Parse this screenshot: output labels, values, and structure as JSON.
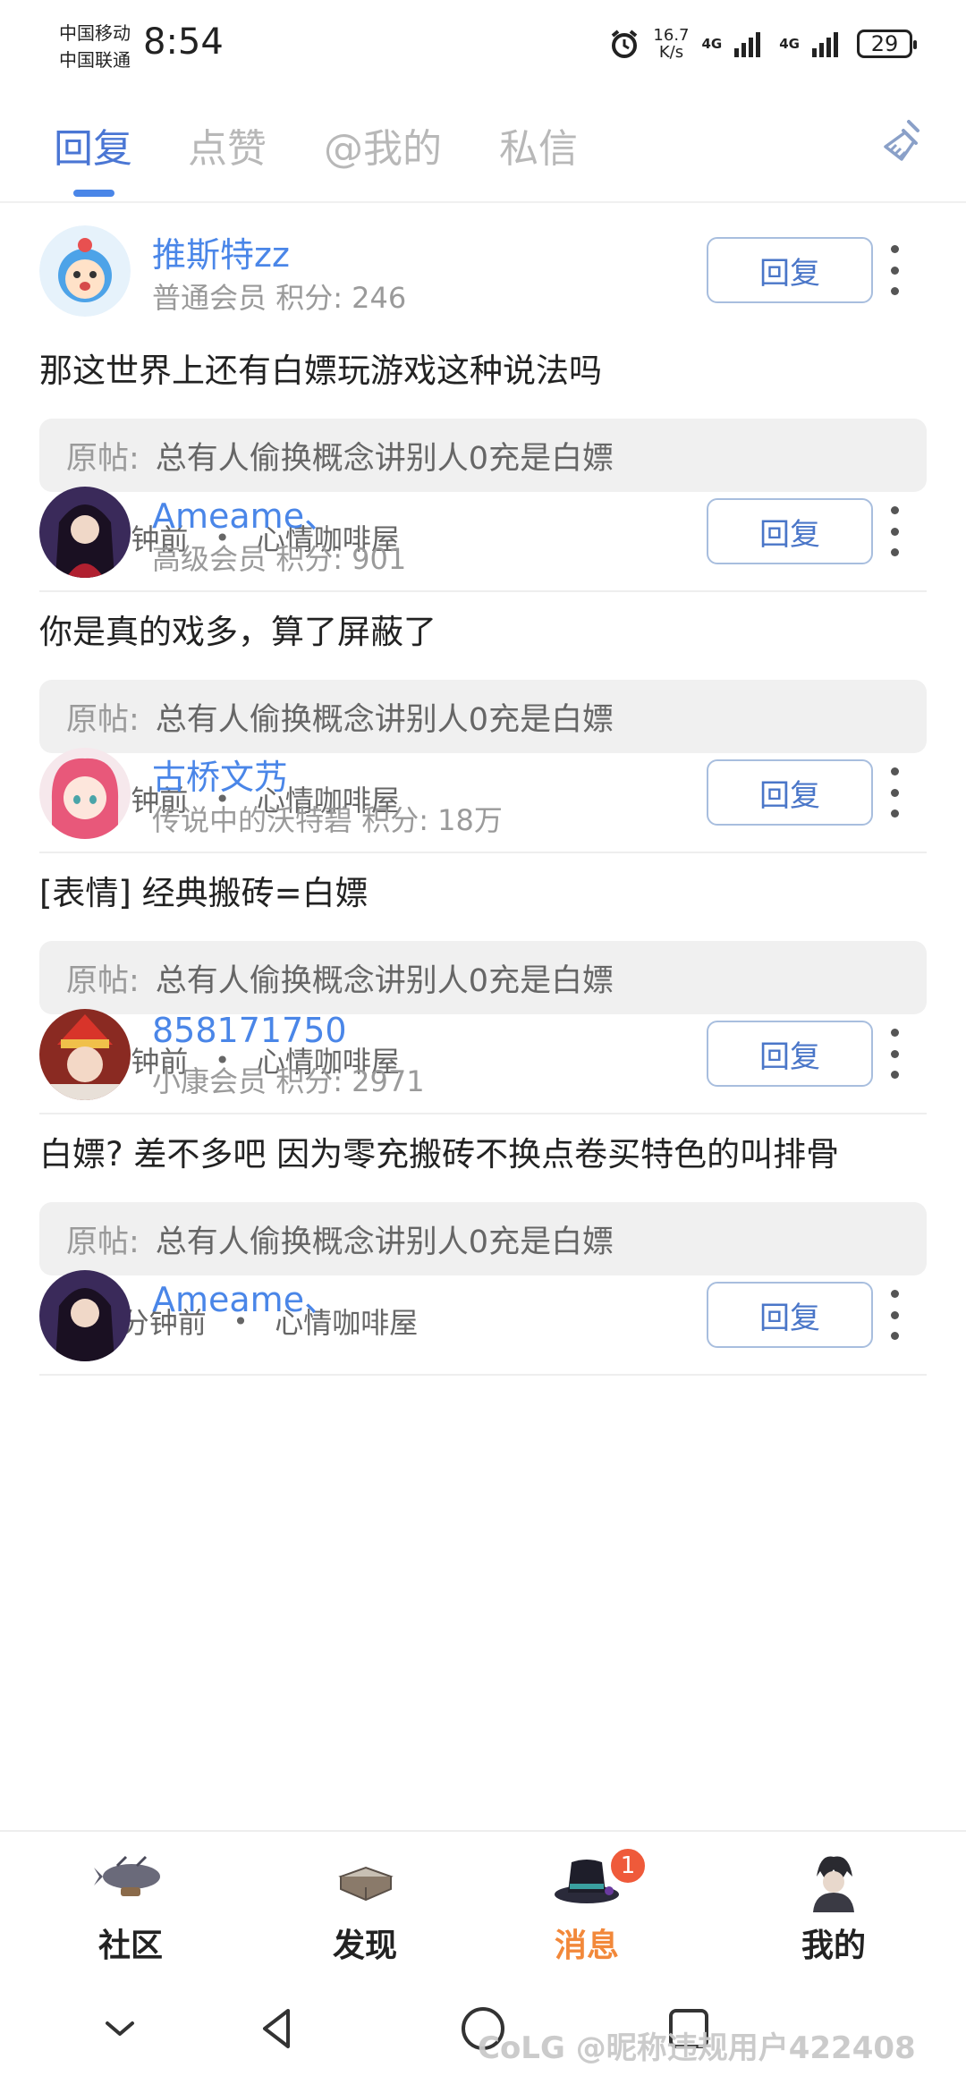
{
  "status_bar": {
    "carrier_1": "中国移动",
    "carrier_2": "中国联通",
    "time": "8:54",
    "speed_value": "16.7",
    "speed_unit": "K/s",
    "net_1": "4G",
    "net_2": "4G",
    "battery": "29"
  },
  "tabs": [
    {
      "label": "回复"
    },
    {
      "label": "点赞"
    },
    {
      "label": "@我的"
    },
    {
      "label": "私信"
    }
  ],
  "reply_items": [
    {
      "username": "推斯特zz",
      "level": "普通会员",
      "score_label": "积分: 246",
      "content": "那这世界上还有白嫖玩游戏这种说法吗",
      "orig_label": "原帖:",
      "orig_text": "总有人偷换概念讲别人0充是白嫖",
      "time": "1分钟前",
      "forum": "心情咖啡屋",
      "reply_label": "回复"
    },
    {
      "username": "Ameame、",
      "level": "高级会员",
      "score_label": "积分: 901",
      "content": "你是真的戏多，算了屏蔽了",
      "orig_label": "原帖:",
      "orig_text": "总有人偷换概念讲别人0充是白嫖",
      "time": "3分钟前",
      "forum": "心情咖啡屋",
      "reply_label": "回复"
    },
    {
      "username": "古桥文艿",
      "level": "传说中的沃特碧",
      "score_label": "积分: 18万",
      "content": "[表情] 经典搬砖=白嫖",
      "orig_label": "原帖:",
      "orig_text": "总有人偷换概念讲别人0充是白嫖",
      "time": "8分钟前",
      "forum": "心情咖啡屋",
      "reply_label": "回复"
    },
    {
      "username": "858171750",
      "level": "小康会员",
      "score_label": "积分: 2971",
      "content": "白嫖? 差不多吧 因为零充搬砖不换点卷买特色的叫排骨",
      "orig_label": "原帖:",
      "orig_text": "总有人偷换概念讲别人0充是白嫖",
      "time": "10分钟前",
      "forum": "心情咖啡屋",
      "reply_label": "回复"
    },
    {
      "username": "Ameame、",
      "level": "",
      "score_label": "",
      "content": "",
      "orig_label": "",
      "orig_text": "",
      "time": "",
      "forum": "",
      "reply_label": "回复"
    }
  ],
  "bottom_nav": [
    {
      "label": "社区"
    },
    {
      "label": "发现"
    },
    {
      "label": "消息",
      "badge": "1"
    },
    {
      "label": "我的"
    }
  ],
  "watermark": "CoLG @昵称违规用户422408",
  "colors": {
    "accent": "#4a86e8",
    "active_nav": "#f2883a",
    "badge": "#ef5a3a"
  }
}
